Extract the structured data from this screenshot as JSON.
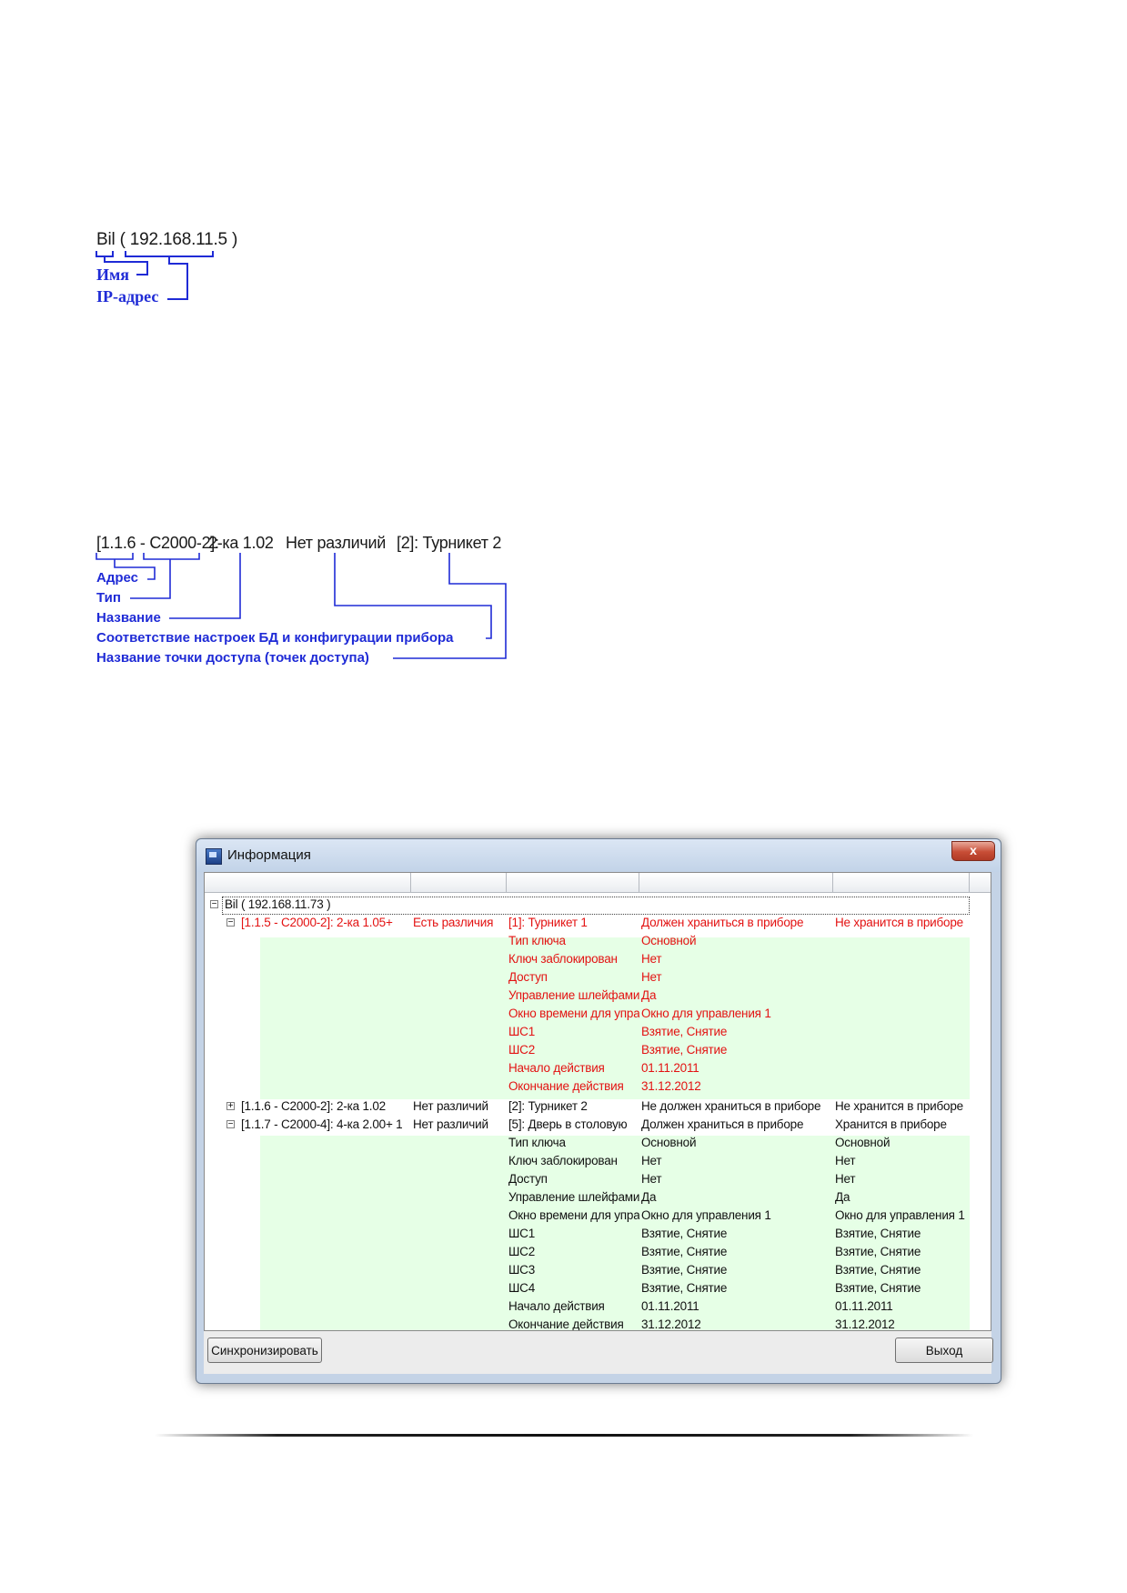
{
  "diagram1": {
    "text": "Bil ( 192.168.11.5 )",
    "labels": [
      "Имя",
      "IP-адрес"
    ]
  },
  "diagram2": {
    "parts": [
      "[1.1.6 - С2000-2]:",
      "2-ка 1.02",
      "Нет различий",
      "[2]: Турникет 2"
    ],
    "labels": [
      "Адрес",
      "Тип",
      "Название",
      "Соответствие настроек БД и конфигурации прибора",
      "Название точки доступа (точек доступа)"
    ]
  },
  "window": {
    "title": "Информация",
    "close_label": "x",
    "root_label": "Bil ( 192.168.11.73 )",
    "device1": {
      "columns": [
        "[1.1.5 - С2000-2]: 2-ка 1.05+",
        "Есть различия",
        "[1]: Турникет 1",
        "Должен храниться в приборе",
        "Не хранится в приборе"
      ],
      "details": [
        [
          "Тип ключа",
          "Основной"
        ],
        [
          "Ключ заблокирован",
          "Нет"
        ],
        [
          "Доступ",
          "Нет"
        ],
        [
          "Управление шлейфами",
          "Да"
        ],
        [
          "Окно времени для управления",
          "Окно для управления 1"
        ],
        [
          "ШС1",
          "Взятие, Снятие"
        ],
        [
          "ШС2",
          "Взятие, Снятие"
        ],
        [
          "Начало действия",
          "01.11.2011"
        ],
        [
          "Окончание действия",
          "31.12.2012"
        ]
      ]
    },
    "device2": {
      "columns": [
        "[1.1.6 - С2000-2]: 2-ка 1.02",
        "Нет различий",
        "[2]: Турникет 2",
        "Не должен храниться в приборе",
        "Не хранится в приборе"
      ]
    },
    "device3": {
      "columns": [
        "[1.1.7 - С2000-4]: 4-ка 2.00+ 1",
        "Нет различий",
        "[5]: Дверь в столовую",
        "Должен храниться в приборе",
        "Хранится в приборе"
      ],
      "details": [
        [
          "Тип ключа",
          "Основной",
          "Основной"
        ],
        [
          "Ключ заблокирован",
          "Нет",
          "Нет"
        ],
        [
          "Доступ",
          "Нет",
          "Нет"
        ],
        [
          "Управление шлейфами",
          "Да",
          "Да"
        ],
        [
          "Окно времени для управления",
          "Окно для управления 1",
          "Окно для управления 1"
        ],
        [
          "ШС1",
          "Взятие, Снятие",
          "Взятие, Снятие"
        ],
        [
          "ШС2",
          "Взятие, Снятие",
          "Взятие, Снятие"
        ],
        [
          "ШС3",
          "Взятие, Снятие",
          "Взятие, Снятие"
        ],
        [
          "ШС4",
          "Взятие, Снятие",
          "Взятие, Снятие"
        ],
        [
          "Начало действия",
          "01.11.2011",
          "01.11.2011"
        ],
        [
          "Окончание действия",
          "31.12.2012",
          "31.12.2012"
        ]
      ]
    },
    "sync_button": "Синхронизировать",
    "exit_button": "Выход"
  }
}
